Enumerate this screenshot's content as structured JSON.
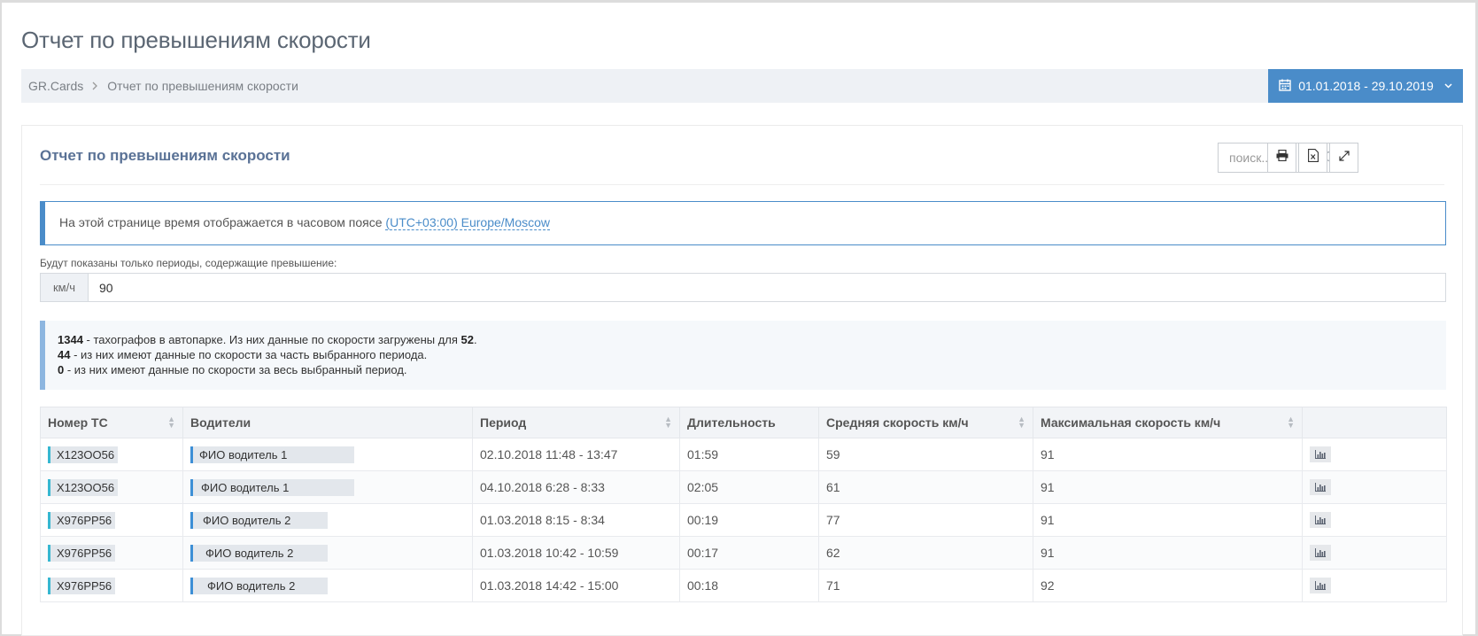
{
  "page": {
    "title": "Отчет по превышениям скорости"
  },
  "breadcrumb": {
    "items": [
      {
        "label": "GR.Cards"
      },
      {
        "label": "Отчет по превышениям скорости"
      }
    ],
    "separator": ">"
  },
  "date_range": {
    "label": "01.01.2018 - 29.10.2019"
  },
  "portlet": {
    "title": "Отчет по превышениям скорости",
    "search_placeholder": "поиск..."
  },
  "timezone_note": {
    "text": "На этой странице время отображается в часовом поясе ",
    "link": "(UTC+03:00) Europe/Moscow"
  },
  "speed_filter": {
    "label": "Будут показаны только периоды, содержащие превышение:",
    "unit": "км/ч",
    "value": "90"
  },
  "stats": {
    "line1_count": "1344",
    "line1_text": " - тахографов в автопарке. Из них данные по скорости загружены для ",
    "line1_loaded": "52",
    "line1_end": ".",
    "line2_count": "44",
    "line2_text": " - из них имеют данные по скорости за часть выбранного периода.",
    "line3_count": "0",
    "line3_text": " - из них имеют данные по скорости за весь выбранный период."
  },
  "table": {
    "headers": [
      "Номер ТС",
      "Водители",
      "Период",
      "Длительность",
      "Средняя скорость км/ч",
      "Максимальная скорость км/ч",
      ""
    ],
    "rows": [
      {
        "plate": "X123OO56",
        "driver": "ФИО водитель 1",
        "period": "02.10.2018 11:48 - 13:47",
        "duration": "01:59",
        "avg": "59",
        "max": "91"
      },
      {
        "plate": "X123OO56",
        "driver": "ФИО водитель 1",
        "period": "04.10.2018 6:28 - 8:33",
        "duration": "02:05",
        "avg": "61",
        "max": "91"
      },
      {
        "plate": "X976PP56",
        "driver": "ФИО водитель 2",
        "period": "01.03.2018 8:15 - 8:34",
        "duration": "00:19",
        "avg": "77",
        "max": "91"
      },
      {
        "plate": "X976PP56",
        "driver": "ФИО водитель 2",
        "period": "01.03.2018 10:42 - 10:59",
        "duration": "00:17",
        "avg": "62",
        "max": "91"
      },
      {
        "plate": "X976PP56",
        "driver": "ФИО водитель 2",
        "period": "01.03.2018 14:42 - 15:00",
        "duration": "00:18",
        "avg": "71",
        "max": "92"
      }
    ]
  },
  "colors": {
    "accent": "#4a8cc9",
    "title": "#5a7296",
    "plate_bar": "#36b7d1",
    "driver_bar": "#3d8fd6"
  },
  "icons": {
    "date": "calendar-icon",
    "search": "search-icon",
    "print": "print-icon",
    "excel": "excel-icon",
    "fullscreen": "fullscreen-icon",
    "chart": "bar-chart-icon"
  }
}
